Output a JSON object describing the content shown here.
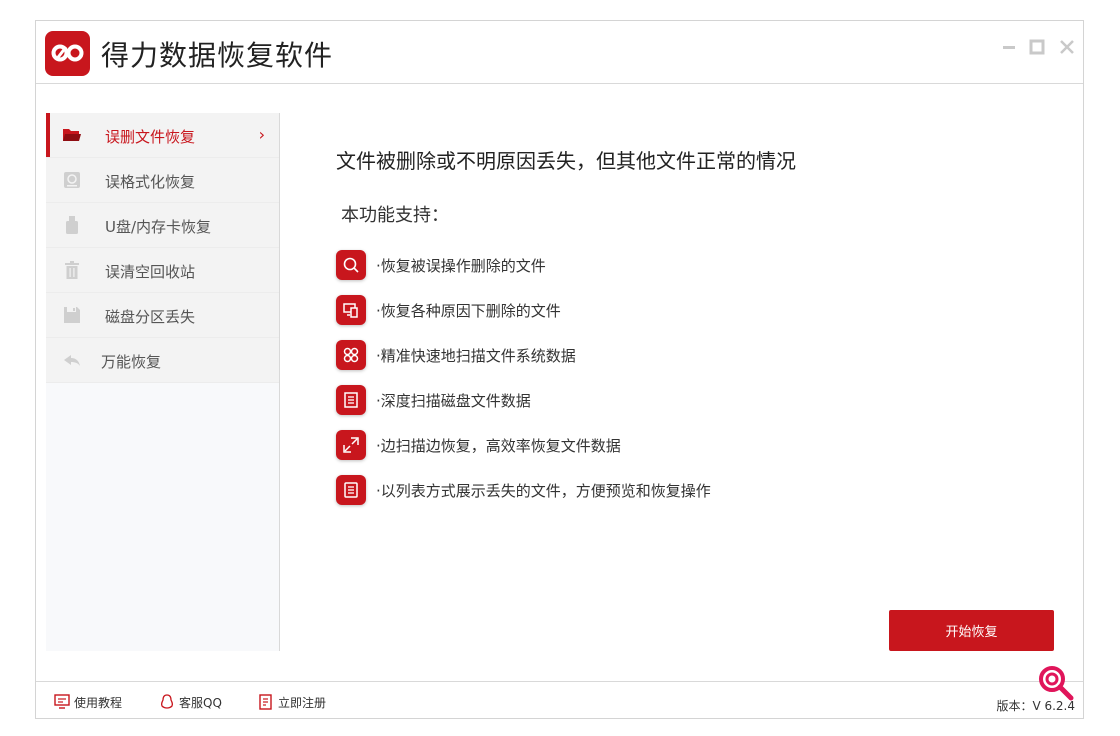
{
  "app": {
    "title": "得力数据恢复软件"
  },
  "sidebar": {
    "items": [
      {
        "label": "误删文件恢复",
        "icon": "folder-icon",
        "active": true
      },
      {
        "label": "误格式化恢复",
        "icon": "disk-format-icon"
      },
      {
        "label": "U盘/内存卡恢复",
        "icon": "usb-drive-icon"
      },
      {
        "label": "误清空回收站",
        "icon": "trash-icon"
      },
      {
        "label": "磁盘分区丢失",
        "icon": "save-disk-icon"
      },
      {
        "label": "万能恢复",
        "icon": "undo-arrow-icon"
      }
    ]
  },
  "main": {
    "headline": "文件被删除或不明原因丢失，但其他文件正常的情况",
    "support_title": "本功能支持：",
    "features": [
      {
        "text": "·恢复被误操作删除的文件",
        "icon": "search-icon"
      },
      {
        "text": "·恢复各种原因下删除的文件",
        "icon": "devices-icon"
      },
      {
        "text": "·精准快速地扫描文件系统数据",
        "icon": "grid-icon"
      },
      {
        "text": "·深度扫描磁盘文件数据",
        "icon": "scan-doc-icon"
      },
      {
        "text": "·边扫描边恢复，高效率恢复文件数据",
        "icon": "compress-icon"
      },
      {
        "text": "·以列表方式展示丢失的文件，方便预览和恢复操作",
        "icon": "list-icon"
      }
    ],
    "start_button": "开始恢复"
  },
  "statusbar": {
    "tutorial": "使用教程",
    "qq": "客服QQ",
    "register": "立即注册",
    "version": "版本：V 6.2.4"
  },
  "colors": {
    "accent": "#c8161d"
  }
}
